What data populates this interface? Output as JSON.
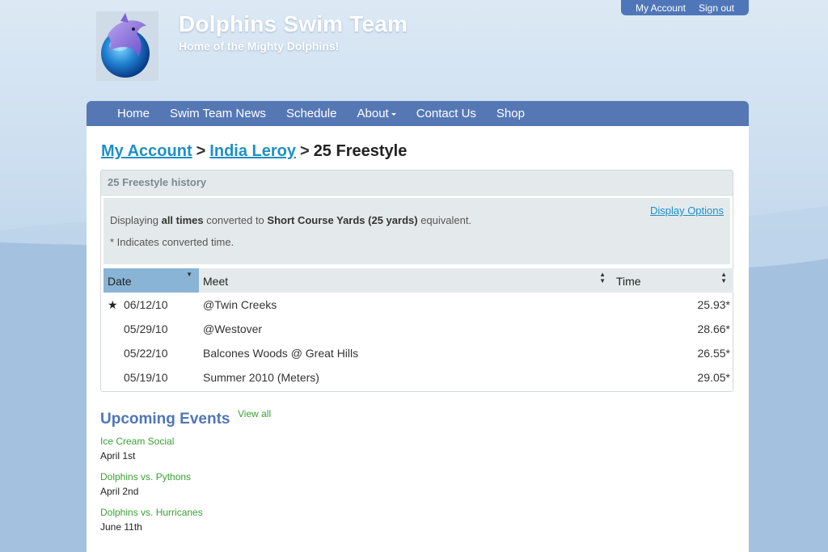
{
  "header": {
    "title": "Dolphins Swim Team",
    "tagline": "Home of the Mighty Dolphins!"
  },
  "account_bar": {
    "my_account": "My Account",
    "sign_out": "Sign out"
  },
  "nav": {
    "items": [
      "Home",
      "Swim Team News",
      "Schedule",
      "About",
      "Contact Us",
      "Shop"
    ]
  },
  "breadcrumb": {
    "level1": "My Account",
    "level2": "India Leroy",
    "current": "25 Freestyle",
    "separator": ">"
  },
  "panel": {
    "title": "25 Freestyle history",
    "display_options": "Display Options",
    "notice_prefix": "Displaying ",
    "notice_bold1": "all times",
    "notice_mid": " converted to ",
    "notice_bold2": "Short Course Yards (25 yards)",
    "notice_suffix": " equivalent.",
    "notice_line2": "* Indicates converted time."
  },
  "table": {
    "headers": {
      "date": "Date",
      "meet": "Meet",
      "time": "Time"
    },
    "rows": [
      {
        "date": "06/12/10",
        "meet": "@Twin Creeks",
        "time": "25.93*",
        "starred": true
      },
      {
        "date": "05/29/10",
        "meet": "@Westover",
        "time": "28.66*",
        "starred": false
      },
      {
        "date": "05/22/10",
        "meet": "Balcones Woods @ Great Hills",
        "time": "26.55*",
        "starred": false
      },
      {
        "date": "05/19/10",
        "meet": "Summer 2010 (Meters)",
        "time": "29.05*",
        "starred": false
      }
    ]
  },
  "upcoming": {
    "title": "Upcoming Events",
    "view_all": "View all",
    "events": [
      {
        "name": "Ice Cream Social",
        "date": "April 1st"
      },
      {
        "name": "Dolphins vs. Pythons",
        "date": "April 2nd"
      },
      {
        "name": "Dolphins vs. Hurricanes",
        "date": "June 11th"
      }
    ]
  },
  "colors": {
    "brand_blue": "#5578b5",
    "link_blue": "#1f8fc7",
    "event_green": "#3aa035",
    "sorted_header": "#8ab4d6"
  }
}
